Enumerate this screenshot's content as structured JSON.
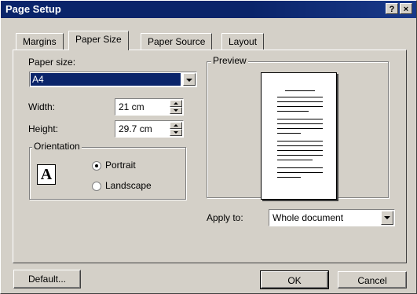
{
  "window": {
    "title": "Page Setup",
    "help_button": "?",
    "close_button": "×"
  },
  "tabs": [
    {
      "label": "Margins",
      "active": false
    },
    {
      "label": "Paper Size",
      "active": true
    },
    {
      "label": "Paper Source",
      "active": false
    },
    {
      "label": "Layout",
      "active": false
    }
  ],
  "paper_size": {
    "label": "Paper size:",
    "value": "A4"
  },
  "width": {
    "label": "Width:",
    "value": "21 cm"
  },
  "height": {
    "label": "Height:",
    "value": "29.7 cm"
  },
  "orientation": {
    "label": "Orientation",
    "icon_letter": "A",
    "portrait_label": "Portrait",
    "landscape_label": "Landscape",
    "selected": "portrait"
  },
  "preview": {
    "label": "Preview"
  },
  "apply_to": {
    "label": "Apply to:",
    "value": "Whole document"
  },
  "buttons": {
    "default": "Default...",
    "ok": "OK",
    "cancel": "Cancel"
  }
}
